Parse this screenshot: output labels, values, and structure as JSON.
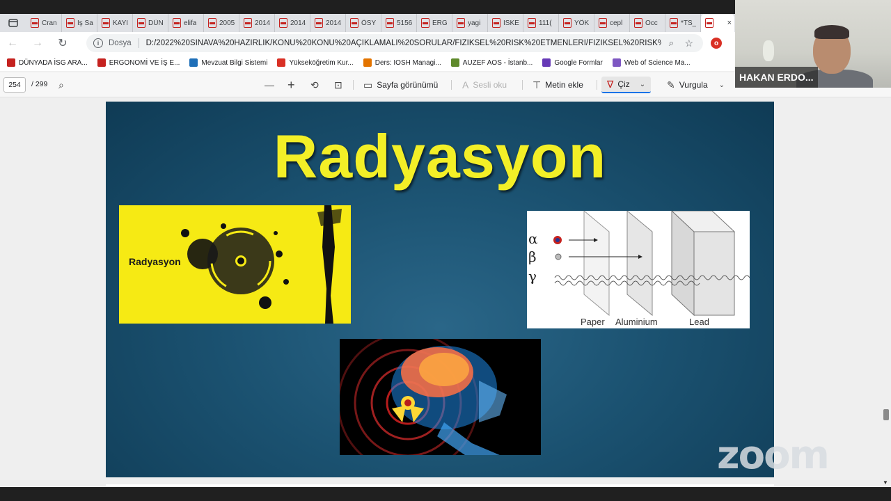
{
  "tabs": [
    {
      "title": "Cran"
    },
    {
      "title": "İş Sa"
    },
    {
      "title": "KAYI"
    },
    {
      "title": "DÜN"
    },
    {
      "title": "elifa"
    },
    {
      "title": "2005"
    },
    {
      "title": "2014"
    },
    {
      "title": "2014"
    },
    {
      "title": "2014"
    },
    {
      "title": "ÖSY"
    },
    {
      "title": "5156"
    },
    {
      "title": "ERG"
    },
    {
      "title": "yagi"
    },
    {
      "title": "İSKE"
    },
    {
      "title": "111("
    },
    {
      "title": "YÖK"
    },
    {
      "title": "cepl"
    },
    {
      "title": "Occ"
    },
    {
      "title": "*TS_"
    }
  ],
  "active_tab": {
    "close": "×"
  },
  "address": {
    "scheme": "Dosya",
    "url": "D:/2022%20SINAVA%20HAZIRLIK/KONU%20KONU%20AÇIKLAMALI%20SORULAR/FİZİKSEL%20RİSK%20ETMENLERİ/FİZİKSEL%20RİSK%20ET..."
  },
  "bookmarks": [
    {
      "label": "DÜNYADA İSG ARA...",
      "color": "#c5221f"
    },
    {
      "label": "ERGONOMİ VE İŞ E...",
      "color": "#c5221f"
    },
    {
      "label": "Mevzuat Bilgi Sistemi",
      "color": "#1e6fb8"
    },
    {
      "label": "Yükseköğretim Kur...",
      "color": "#d93025"
    },
    {
      "label": "Ders: IOSH Managi...",
      "color": "#e37400"
    },
    {
      "label": "AUZEF AOS - İstanb...",
      "color": "#5f8a2c"
    },
    {
      "label": "Google Formlar",
      "color": "#673ab7"
    },
    {
      "label": "Web of Science Ma...",
      "color": "#7e57c2"
    }
  ],
  "pdf_toolbar": {
    "page": "254",
    "total": "/ 299",
    "page_view": "Sayfa görünümü",
    "read_aloud": "Sesli oku",
    "add_text": "Metin ekle",
    "draw": "Çiz",
    "highlight": "Vurgula"
  },
  "webcam": {
    "name": "HAKAN ERDO..."
  },
  "slide": {
    "title": "Radyasyon",
    "image1_label": "Radyasyon",
    "penetration": {
      "symbols": [
        "α",
        "β",
        "γ"
      ],
      "labels": [
        "Paper",
        "Aluminium",
        "Lead"
      ]
    }
  },
  "zoom_watermark": "zoom"
}
